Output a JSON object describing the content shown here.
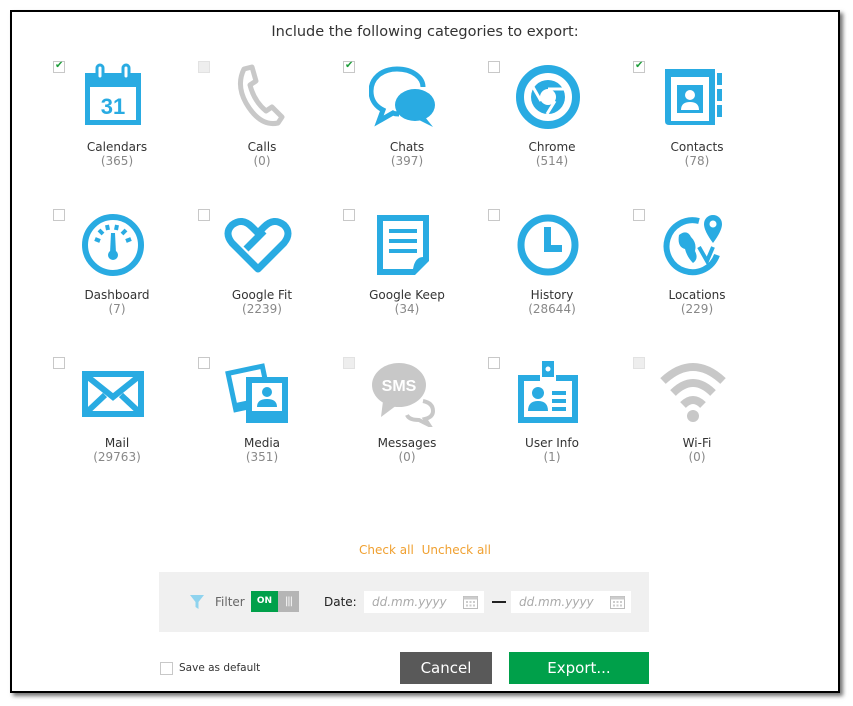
{
  "dialog": {
    "title": "Include the following categories to export:"
  },
  "colors": {
    "icon_active": "#29abe2",
    "icon_disabled": "#c8c8c8",
    "check": "#1f9e3c",
    "link": "#f0a030",
    "toggle_on": "#00a04a",
    "cancel_bg": "#595959",
    "export_bg": "#00a04a"
  },
  "categories": [
    {
      "label": "Calendars",
      "count": "(365)",
      "checked": true,
      "disabled": false,
      "icon": "calendar-icon"
    },
    {
      "label": "Calls",
      "count": "(0)",
      "checked": false,
      "disabled": true,
      "icon": "phone-icon"
    },
    {
      "label": "Chats",
      "count": "(397)",
      "checked": true,
      "disabled": false,
      "icon": "chat-bubbles-icon"
    },
    {
      "label": "Chrome",
      "count": "(514)",
      "checked": false,
      "disabled": false,
      "icon": "chrome-icon"
    },
    {
      "label": "Contacts",
      "count": "(78)",
      "checked": true,
      "disabled": false,
      "icon": "address-book-icon"
    },
    {
      "label": "Dashboard",
      "count": "(7)",
      "checked": false,
      "disabled": false,
      "icon": "gauge-icon"
    },
    {
      "label": "Google Fit",
      "count": "(2239)",
      "checked": false,
      "disabled": false,
      "icon": "heart-icon"
    },
    {
      "label": "Google Keep",
      "count": "(34)",
      "checked": false,
      "disabled": false,
      "icon": "note-icon"
    },
    {
      "label": "History",
      "count": "(28644)",
      "checked": false,
      "disabled": false,
      "icon": "clock-icon"
    },
    {
      "label": "Locations",
      "count": "(229)",
      "checked": false,
      "disabled": false,
      "icon": "globe-pin-icon"
    },
    {
      "label": "Mail",
      "count": "(29763)",
      "checked": false,
      "disabled": false,
      "icon": "envelope-icon"
    },
    {
      "label": "Media",
      "count": "(351)",
      "checked": false,
      "disabled": false,
      "icon": "photos-icon"
    },
    {
      "label": "Messages",
      "count": "(0)",
      "checked": false,
      "disabled": true,
      "icon": "sms-icon",
      "icon_text": "SMS"
    },
    {
      "label": "User Info",
      "count": "(1)",
      "checked": false,
      "disabled": false,
      "icon": "id-badge-icon"
    },
    {
      "label": "Wi-Fi",
      "count": "(0)",
      "checked": false,
      "disabled": true,
      "icon": "wifi-icon"
    }
  ],
  "calendar_day": "31",
  "links": {
    "check_all": "Check all",
    "uncheck_all": "Uncheck all"
  },
  "filter": {
    "label": "Filter",
    "toggle_on_label": "ON",
    "toggle_off_glyph": "|||",
    "enabled": true,
    "date_label": "Date:",
    "date_from_placeholder": "dd.mm.yyyy",
    "date_to_placeholder": "dd.mm.yyyy",
    "date_from_value": "",
    "date_to_value": ""
  },
  "footer": {
    "save_default_label": "Save as default",
    "save_default_checked": false,
    "cancel_label": "Cancel",
    "export_label": "Export..."
  }
}
